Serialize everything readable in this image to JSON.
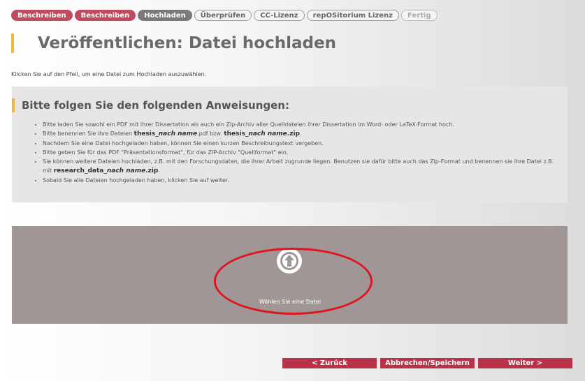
{
  "steps": [
    {
      "label": "Beschreiben",
      "state": "done"
    },
    {
      "label": "Beschreiben",
      "state": "done"
    },
    {
      "label": "Hochladen",
      "state": "active"
    },
    {
      "label": "Überprüfen",
      "state": "todo"
    },
    {
      "label": "CC-Lizenz",
      "state": "todo"
    },
    {
      "label": "repOSitorium Lizenz",
      "state": "todo"
    },
    {
      "label": "Fertig",
      "state": "todo"
    }
  ],
  "page_title": "Veröffentlichen: Datei hochladen",
  "intro_text": "Klicken Sie auf den Pfeil, um eine Datei zum Hochladen auszuwählen.",
  "instructions": {
    "heading": "Bitte folgen Sie den folgenden Anweisungen:",
    "items": {
      "i1": "Bitte laden Sie sowohl ein PDF mit ihrer Dissertation als auch ein Zip-Archiv aller Quelldateien ihrer Dissertation im Word- oder LaTeX-Format hoch.",
      "i2_a": "Bitte benennen Sie ihre Dateien ",
      "i2_b": "thesis_",
      "i2_c": "nach name",
      "i2_d": ".pdf bzw. ",
      "i2_e": "thesis_",
      "i2_f": "nach name",
      "i2_g": ".zip",
      "i2_h": ".",
      "i3": "Nachdem Sie eine Datei hochgeladen haben, können Sie einen kurzen Beschreibungstext vergeben.",
      "i4": "Bitte geben Sie für das PDF \"Präsentationsformat\", für das ZIP-Archiv \"Quellformat\" ein.",
      "i5_a": "Sie können weitere Dateien hochladen, z.B. mit den Forschungsdaten, die ihrer Arbeit zugrunde liegen. Benutzen sie dafür bitte auch das Zip-Format und benennen sie ihre Datei z.B. mit ",
      "i5_b": "research_data_",
      "i5_c": "nach name",
      "i5_d": ".zip",
      "i5_e": ".",
      "i6": "Sobald Sie alle Dateien hochgeladen haben, klicken Sie auf weiter."
    }
  },
  "dropzone": {
    "label": "Wählen Sie eine Datei",
    "icon": "upload-arrow-icon"
  },
  "buttons": {
    "prev": "< Zurück",
    "cancel": "Abbrechen/Speichern",
    "next": "Weiter >"
  },
  "colors": {
    "accent": "#b8334a",
    "highlight": "#f0b93a",
    "dropzone": "#a09696",
    "annotation": "#e0141e"
  }
}
